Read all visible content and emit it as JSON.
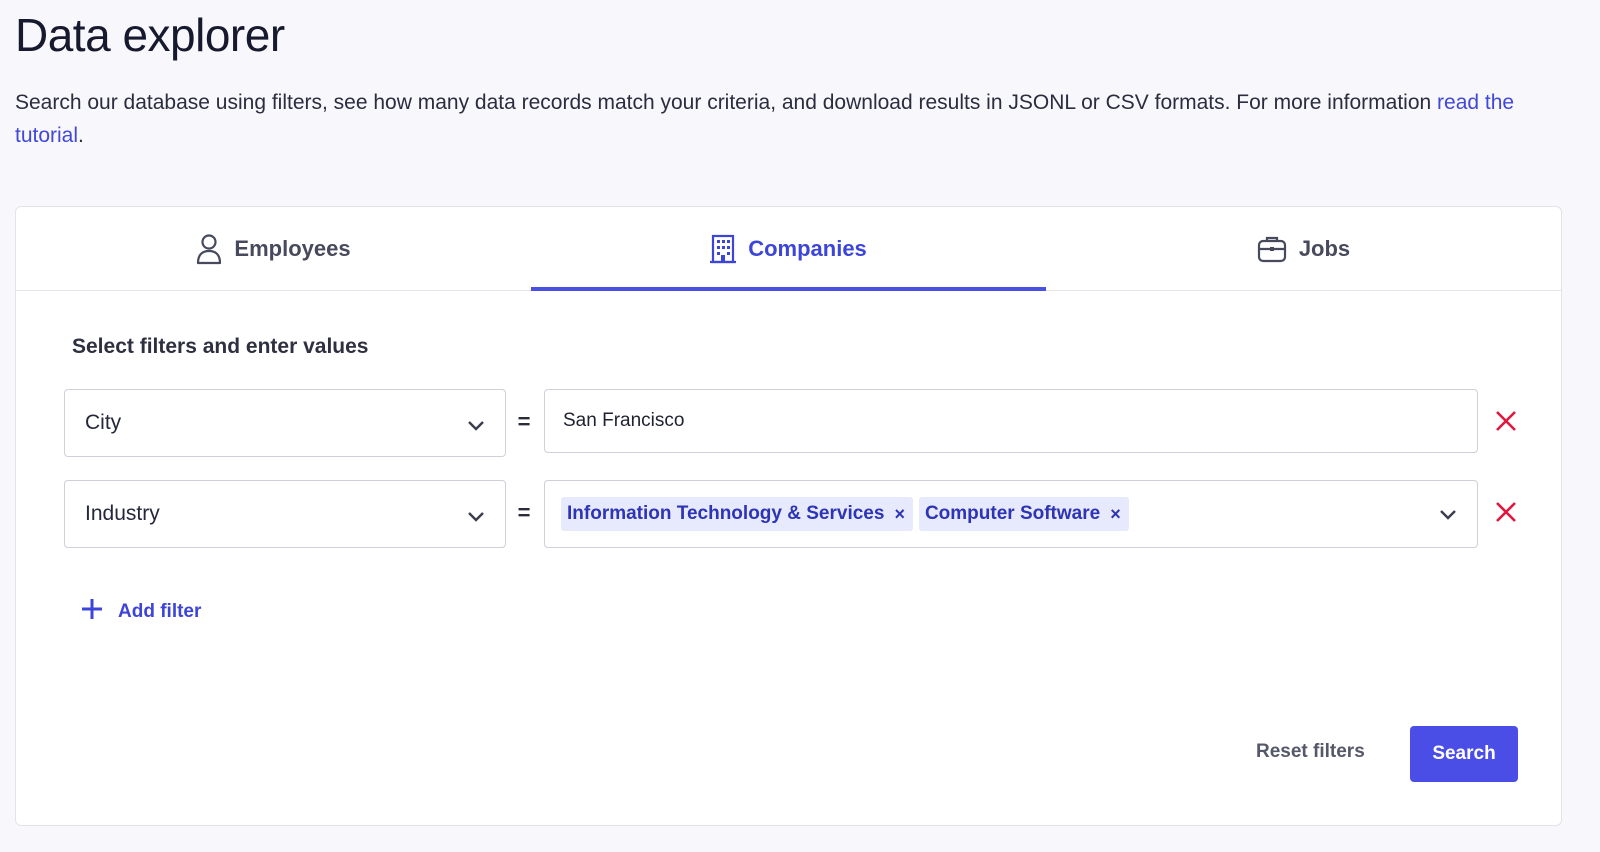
{
  "header": {
    "title": "Data explorer",
    "description": "Search our database using filters, see how many data records match your criteria, and download results in JSONL or CSV formats. For more information ",
    "tutorial_link": "read the tutorial",
    "description_end": "."
  },
  "tabs": [
    {
      "label": "Employees",
      "icon": "person-icon",
      "active": false
    },
    {
      "label": "Companies",
      "icon": "building-icon",
      "active": true
    },
    {
      "label": "Jobs",
      "icon": "briefcase-icon",
      "active": false
    }
  ],
  "filters": {
    "section_label": "Select filters and enter values",
    "operator": "=",
    "rows": [
      {
        "field": "City",
        "value": "San Francisco"
      },
      {
        "field": "Industry",
        "chips": [
          "Information Technology & Services",
          "Computer Software"
        ],
        "chip_remove": "×"
      }
    ],
    "add_filter_label": "Add filter"
  },
  "actions": {
    "reset_label": "Reset filters",
    "search_label": "Search"
  },
  "colors": {
    "accent": "#4a4ee6",
    "remove": "#e0173f",
    "chip_bg": "#e7e9fc"
  }
}
